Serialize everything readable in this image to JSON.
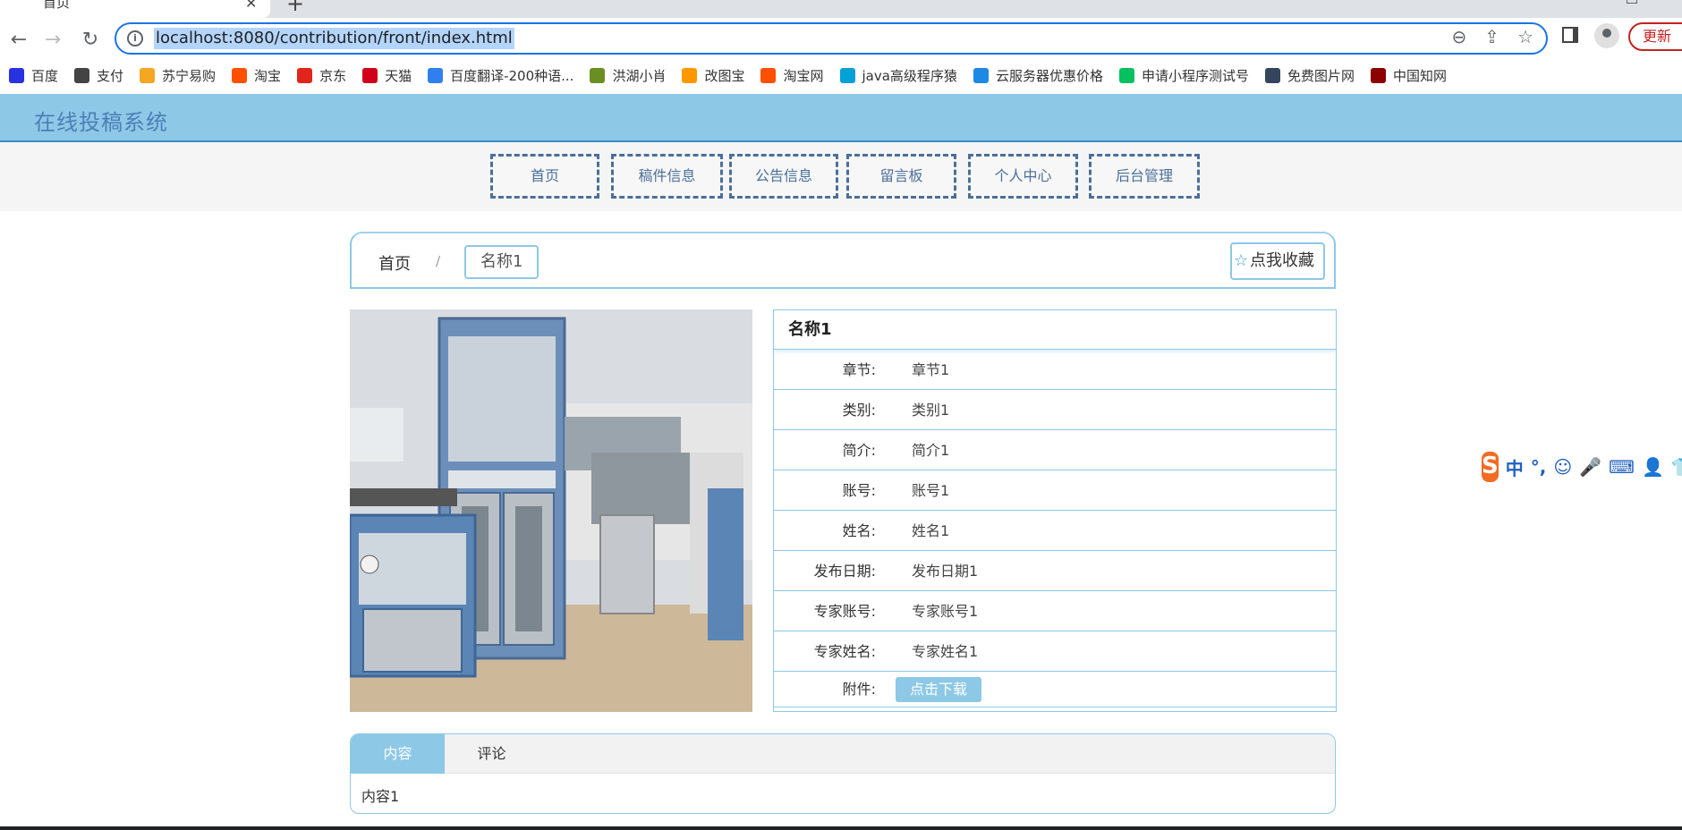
{
  "browser": {
    "tab_title": "首页",
    "url": "localhost:8080/contribution/front/index.html",
    "update_label": "更新",
    "bookmarks": [
      {
        "label": "百度",
        "icon": "baidu-icon",
        "color": "#2932e1"
      },
      {
        "label": "支付",
        "icon": "pay-icon",
        "color": "#444444"
      },
      {
        "label": "苏宁易购",
        "icon": "suning-icon",
        "color": "#f5a623"
      },
      {
        "label": "淘宝",
        "icon": "taobao-icon",
        "color": "#ff5000"
      },
      {
        "label": "京东",
        "icon": "jd-icon",
        "color": "#e1251b"
      },
      {
        "label": "天猫",
        "icon": "tmall-icon",
        "color": "#d0021b"
      },
      {
        "label": "百度翻译-200种语...",
        "icon": "translate-icon",
        "color": "#2f80ed"
      },
      {
        "label": "洪湖小肖",
        "icon": "hhxx-icon",
        "color": "#6b8e23"
      },
      {
        "label": "改图宝",
        "icon": "gaitubao-icon",
        "color": "#ff9800"
      },
      {
        "label": "淘宝网",
        "icon": "taobao2-icon",
        "color": "#ff5000"
      },
      {
        "label": "java高级程序猿",
        "icon": "bilibili-icon",
        "color": "#00a1d6"
      },
      {
        "label": "云服务器优惠价格",
        "icon": "cloud-icon",
        "color": "#1e88e5"
      },
      {
        "label": "申请小程序测试号",
        "icon": "wechat-icon",
        "color": "#07c160"
      },
      {
        "label": "免费图片网",
        "icon": "tumblr-icon",
        "color": "#35465c"
      },
      {
        "label": "中国知网",
        "icon": "cnki-icon",
        "color": "#8b0000"
      }
    ]
  },
  "site": {
    "title": "在线投稿系统"
  },
  "nav": {
    "items": [
      "首页",
      "稿件信息",
      "公告信息",
      "留言板",
      "个人中心",
      "后台管理"
    ]
  },
  "breadcrumb": {
    "home": "首页",
    "separator": "/",
    "current": "名称1",
    "favorite_label": "点我收藏"
  },
  "detail": {
    "title": "名称1",
    "rows": [
      {
        "label": "章节:",
        "value": "章节1"
      },
      {
        "label": "类别:",
        "value": "类别1"
      },
      {
        "label": "简介:",
        "value": "简介1"
      },
      {
        "label": "账号:",
        "value": "账号1"
      },
      {
        "label": "姓名:",
        "value": "姓名1"
      },
      {
        "label": "发布日期:",
        "value": "发布日期1"
      },
      {
        "label": "专家账号:",
        "value": "专家账号1"
      },
      {
        "label": "专家姓名:",
        "value": "专家姓名1"
      }
    ],
    "attachment_label": "附件:",
    "download_label": "点击下载"
  },
  "content": {
    "tabs": [
      "内容",
      "评论"
    ],
    "active_tab": "内容",
    "body": "内容1"
  },
  "ime": {
    "logo": "S",
    "items": [
      "中",
      "°,",
      "☺",
      "🎤",
      "⌨",
      "👤",
      "👕"
    ]
  },
  "colors": {
    "header_bg": "#8dc8e6",
    "accent": "#4a6f9a",
    "border": "#8dc8e6"
  }
}
